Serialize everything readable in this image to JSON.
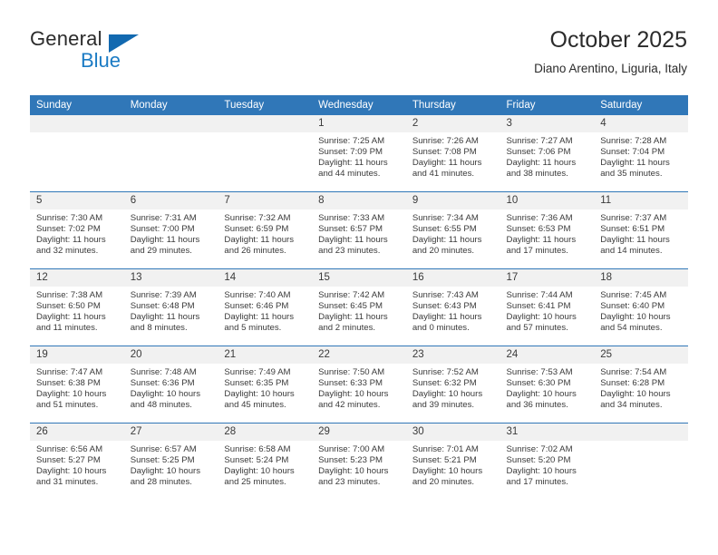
{
  "brand": {
    "name_part1": "General",
    "name_part2": "Blue",
    "triangle_icon": "triangle-logo-icon",
    "colors": {
      "blue": "#1b7bc4",
      "dark": "#2b2b2b",
      "triangle": "#1269b0"
    }
  },
  "header": {
    "title": "October 2025",
    "subtitle": "Diano Arentino, Liguria, Italy"
  },
  "theme": {
    "header_blue": "#3077b8",
    "daynum_band": "#f1f1f1",
    "text": "#3a3a3a"
  },
  "weekdays": [
    "Sunday",
    "Monday",
    "Tuesday",
    "Wednesday",
    "Thursday",
    "Friday",
    "Saturday"
  ],
  "labels": {
    "sunrise_prefix": "Sunrise:",
    "sunset_prefix": "Sunset:",
    "daylight_prefix": "Daylight:"
  },
  "weeks": [
    [
      {
        "day": "",
        "empty": true
      },
      {
        "day": "",
        "empty": true
      },
      {
        "day": "",
        "empty": true
      },
      {
        "day": "1",
        "sunrise": "Sunrise: 7:25 AM",
        "sunset": "Sunset: 7:09 PM",
        "daylight_line1": "Daylight: 11 hours",
        "daylight_line2": "and 44 minutes."
      },
      {
        "day": "2",
        "sunrise": "Sunrise: 7:26 AM",
        "sunset": "Sunset: 7:08 PM",
        "daylight_line1": "Daylight: 11 hours",
        "daylight_line2": "and 41 minutes."
      },
      {
        "day": "3",
        "sunrise": "Sunrise: 7:27 AM",
        "sunset": "Sunset: 7:06 PM",
        "daylight_line1": "Daylight: 11 hours",
        "daylight_line2": "and 38 minutes."
      },
      {
        "day": "4",
        "sunrise": "Sunrise: 7:28 AM",
        "sunset": "Sunset: 7:04 PM",
        "daylight_line1": "Daylight: 11 hours",
        "daylight_line2": "and 35 minutes."
      }
    ],
    [
      {
        "day": "5",
        "sunrise": "Sunrise: 7:30 AM",
        "sunset": "Sunset: 7:02 PM",
        "daylight_line1": "Daylight: 11 hours",
        "daylight_line2": "and 32 minutes."
      },
      {
        "day": "6",
        "sunrise": "Sunrise: 7:31 AM",
        "sunset": "Sunset: 7:00 PM",
        "daylight_line1": "Daylight: 11 hours",
        "daylight_line2": "and 29 minutes."
      },
      {
        "day": "7",
        "sunrise": "Sunrise: 7:32 AM",
        "sunset": "Sunset: 6:59 PM",
        "daylight_line1": "Daylight: 11 hours",
        "daylight_line2": "and 26 minutes."
      },
      {
        "day": "8",
        "sunrise": "Sunrise: 7:33 AM",
        "sunset": "Sunset: 6:57 PM",
        "daylight_line1": "Daylight: 11 hours",
        "daylight_line2": "and 23 minutes."
      },
      {
        "day": "9",
        "sunrise": "Sunrise: 7:34 AM",
        "sunset": "Sunset: 6:55 PM",
        "daylight_line1": "Daylight: 11 hours",
        "daylight_line2": "and 20 minutes."
      },
      {
        "day": "10",
        "sunrise": "Sunrise: 7:36 AM",
        "sunset": "Sunset: 6:53 PM",
        "daylight_line1": "Daylight: 11 hours",
        "daylight_line2": "and 17 minutes."
      },
      {
        "day": "11",
        "sunrise": "Sunrise: 7:37 AM",
        "sunset": "Sunset: 6:51 PM",
        "daylight_line1": "Daylight: 11 hours",
        "daylight_line2": "and 14 minutes."
      }
    ],
    [
      {
        "day": "12",
        "sunrise": "Sunrise: 7:38 AM",
        "sunset": "Sunset: 6:50 PM",
        "daylight_line1": "Daylight: 11 hours",
        "daylight_line2": "and 11 minutes."
      },
      {
        "day": "13",
        "sunrise": "Sunrise: 7:39 AM",
        "sunset": "Sunset: 6:48 PM",
        "daylight_line1": "Daylight: 11 hours",
        "daylight_line2": "and 8 minutes."
      },
      {
        "day": "14",
        "sunrise": "Sunrise: 7:40 AM",
        "sunset": "Sunset: 6:46 PM",
        "daylight_line1": "Daylight: 11 hours",
        "daylight_line2": "and 5 minutes."
      },
      {
        "day": "15",
        "sunrise": "Sunrise: 7:42 AM",
        "sunset": "Sunset: 6:45 PM",
        "daylight_line1": "Daylight: 11 hours",
        "daylight_line2": "and 2 minutes."
      },
      {
        "day": "16",
        "sunrise": "Sunrise: 7:43 AM",
        "sunset": "Sunset: 6:43 PM",
        "daylight_line1": "Daylight: 11 hours",
        "daylight_line2": "and 0 minutes."
      },
      {
        "day": "17",
        "sunrise": "Sunrise: 7:44 AM",
        "sunset": "Sunset: 6:41 PM",
        "daylight_line1": "Daylight: 10 hours",
        "daylight_line2": "and 57 minutes."
      },
      {
        "day": "18",
        "sunrise": "Sunrise: 7:45 AM",
        "sunset": "Sunset: 6:40 PM",
        "daylight_line1": "Daylight: 10 hours",
        "daylight_line2": "and 54 minutes."
      }
    ],
    [
      {
        "day": "19",
        "sunrise": "Sunrise: 7:47 AM",
        "sunset": "Sunset: 6:38 PM",
        "daylight_line1": "Daylight: 10 hours",
        "daylight_line2": "and 51 minutes."
      },
      {
        "day": "20",
        "sunrise": "Sunrise: 7:48 AM",
        "sunset": "Sunset: 6:36 PM",
        "daylight_line1": "Daylight: 10 hours",
        "daylight_line2": "and 48 minutes."
      },
      {
        "day": "21",
        "sunrise": "Sunrise: 7:49 AM",
        "sunset": "Sunset: 6:35 PM",
        "daylight_line1": "Daylight: 10 hours",
        "daylight_line2": "and 45 minutes."
      },
      {
        "day": "22",
        "sunrise": "Sunrise: 7:50 AM",
        "sunset": "Sunset: 6:33 PM",
        "daylight_line1": "Daylight: 10 hours",
        "daylight_line2": "and 42 minutes."
      },
      {
        "day": "23",
        "sunrise": "Sunrise: 7:52 AM",
        "sunset": "Sunset: 6:32 PM",
        "daylight_line1": "Daylight: 10 hours",
        "daylight_line2": "and 39 minutes."
      },
      {
        "day": "24",
        "sunrise": "Sunrise: 7:53 AM",
        "sunset": "Sunset: 6:30 PM",
        "daylight_line1": "Daylight: 10 hours",
        "daylight_line2": "and 36 minutes."
      },
      {
        "day": "25",
        "sunrise": "Sunrise: 7:54 AM",
        "sunset": "Sunset: 6:28 PM",
        "daylight_line1": "Daylight: 10 hours",
        "daylight_line2": "and 34 minutes."
      }
    ],
    [
      {
        "day": "26",
        "sunrise": "Sunrise: 6:56 AM",
        "sunset": "Sunset: 5:27 PM",
        "daylight_line1": "Daylight: 10 hours",
        "daylight_line2": "and 31 minutes."
      },
      {
        "day": "27",
        "sunrise": "Sunrise: 6:57 AM",
        "sunset": "Sunset: 5:25 PM",
        "daylight_line1": "Daylight: 10 hours",
        "daylight_line2": "and 28 minutes."
      },
      {
        "day": "28",
        "sunrise": "Sunrise: 6:58 AM",
        "sunset": "Sunset: 5:24 PM",
        "daylight_line1": "Daylight: 10 hours",
        "daylight_line2": "and 25 minutes."
      },
      {
        "day": "29",
        "sunrise": "Sunrise: 7:00 AM",
        "sunset": "Sunset: 5:23 PM",
        "daylight_line1": "Daylight: 10 hours",
        "daylight_line2": "and 23 minutes."
      },
      {
        "day": "30",
        "sunrise": "Sunrise: 7:01 AM",
        "sunset": "Sunset: 5:21 PM",
        "daylight_line1": "Daylight: 10 hours",
        "daylight_line2": "and 20 minutes."
      },
      {
        "day": "31",
        "sunrise": "Sunrise: 7:02 AM",
        "sunset": "Sunset: 5:20 PM",
        "daylight_line1": "Daylight: 10 hours",
        "daylight_line2": "and 17 minutes."
      },
      {
        "day": "",
        "empty": true
      }
    ]
  ]
}
